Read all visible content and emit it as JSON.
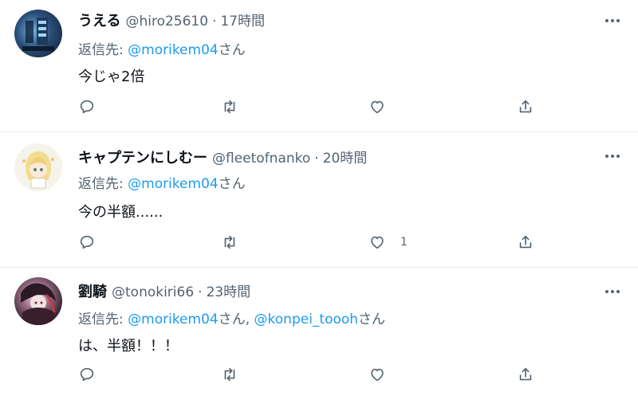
{
  "tweets": [
    {
      "name": "うえる",
      "handle": "@hiro25610",
      "separator": "·",
      "time": "17時間",
      "reply_label": "返信先: ",
      "mentions": [
        "@morikem04"
      ],
      "mention_suffix": "さん",
      "text": "今じゃ2倍",
      "like_count": ""
    },
    {
      "name": "キャプテンにしむー",
      "handle": "@fleetofnanko",
      "separator": "·",
      "time": "20時間",
      "reply_label": "返信先: ",
      "mentions": [
        "@morikem04"
      ],
      "mention_suffix": "さん",
      "text": "今の半額......",
      "like_count": "1"
    },
    {
      "name": "劉騎",
      "handle": "@tonokiri66",
      "separator": "·",
      "time": "23時間",
      "reply_label": "返信先: ",
      "mentions": [
        "@morikem04",
        "@konpei_toooh"
      ],
      "mention_suffix": "さん",
      "mention_joiner": ", ",
      "text": "は、半額！！！",
      "like_count": ""
    }
  ],
  "icons": {
    "more": "more-horizontal-icon",
    "reply": "reply-icon",
    "retweet": "retweet-icon",
    "like": "heart-icon",
    "share": "share-icon"
  },
  "colors": {
    "text": "#0f1419",
    "secondary": "#536471",
    "link": "#1d9bf0",
    "divider": "#e1e8ed"
  }
}
